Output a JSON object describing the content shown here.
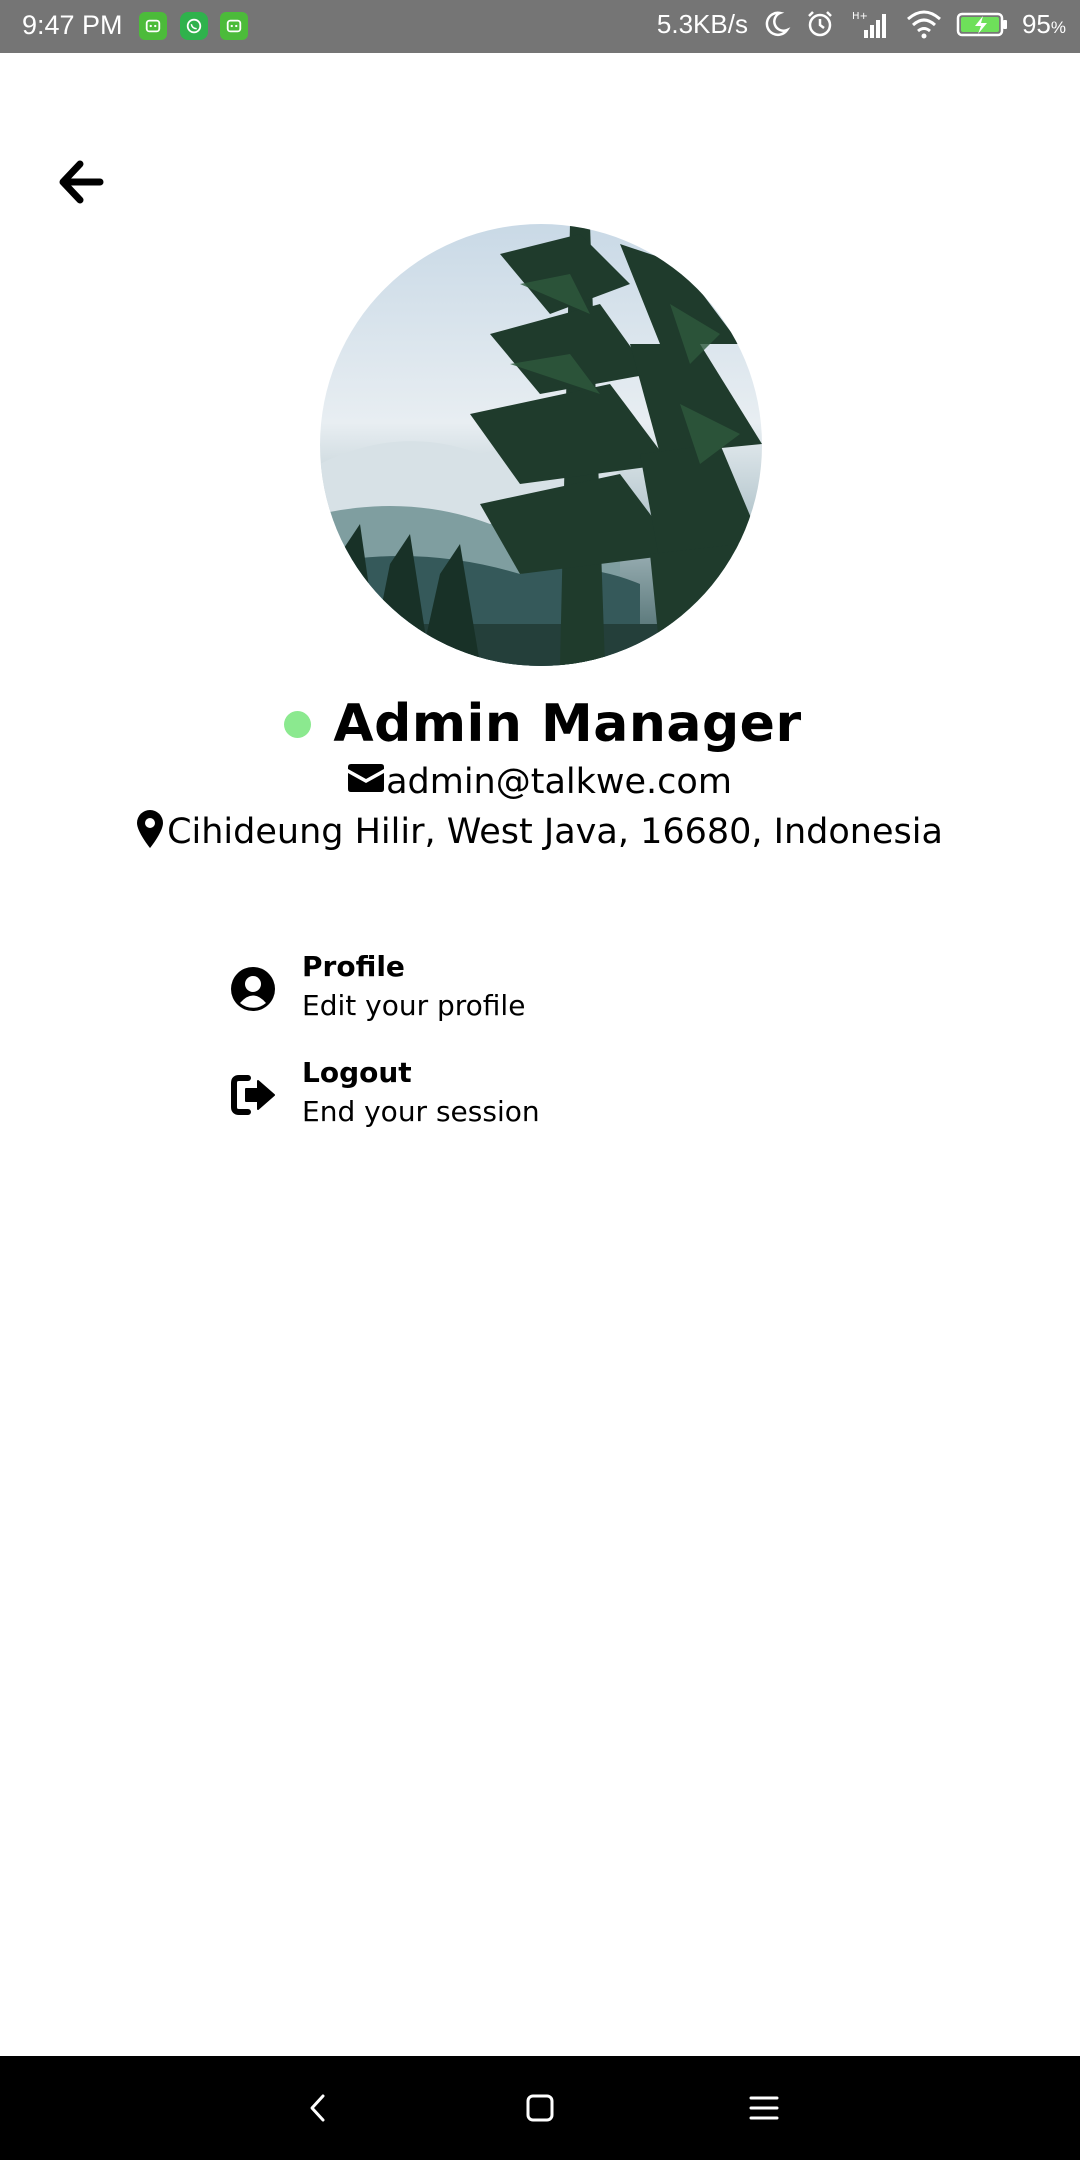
{
  "status_bar": {
    "time": "9:47 PM",
    "network_speed": "5.3KB/s",
    "battery_percent": "95",
    "battery_unit": "%",
    "icons": [
      "app-notification-icon",
      "whatsapp-icon",
      "app-notification-icon",
      "moon-icon",
      "alarm-icon",
      "signal-icon",
      "wifi-icon",
      "battery-charging-icon"
    ]
  },
  "profile": {
    "name": "Admin Manager",
    "email": "admin@talkwe.com",
    "location": "Cihideung Hilir, West Java, 16680, Indonesia",
    "online_color": "#8be98f"
  },
  "menu": {
    "items": [
      {
        "title": "Profile",
        "subtitle": "Edit your profile",
        "icon": "user-circle-icon"
      },
      {
        "title": "Logout",
        "subtitle": "End your session",
        "icon": "sign-out-icon"
      }
    ]
  },
  "nav_bar": {
    "buttons": [
      "back-nav-icon",
      "home-nav-icon",
      "menu-nav-icon"
    ]
  }
}
